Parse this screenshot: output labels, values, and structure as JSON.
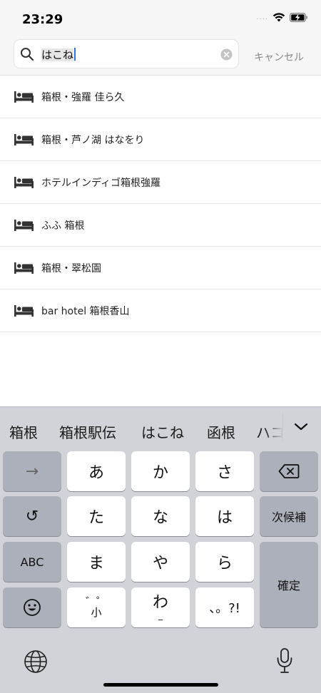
{
  "status_bar": {
    "time": "23:29",
    "signal": "....",
    "icons": [
      "wifi-icon",
      "battery-charging-icon"
    ]
  },
  "search": {
    "query_highlighted": "はこね",
    "cancel_label": "キャンセル",
    "icons": [
      "search-icon",
      "clear-icon"
    ]
  },
  "results": [
    {
      "label": "箱根・強羅 佳ら久",
      "icon": "bed-icon"
    },
    {
      "label": "箱根・芦ノ湖 はなをり",
      "icon": "bed-icon"
    },
    {
      "label": "ホテルインディゴ箱根強羅",
      "icon": "bed-icon"
    },
    {
      "label": "ふふ 箱根",
      "icon": "bed-icon"
    },
    {
      "label": "箱根・翠松園",
      "icon": "bed-icon"
    },
    {
      "label": "bar hotel 箱根香山",
      "icon": "bed-icon"
    }
  ],
  "keyboard": {
    "candidates": [
      "箱根",
      "箱根駅伝",
      "はこね",
      "函根",
      "ハコ"
    ],
    "keys": {
      "arrow": "→",
      "a": "あ",
      "ka": "か",
      "sa": "さ",
      "undo": "↺",
      "ta": "た",
      "na": "な",
      "ha": "は",
      "next_candidate": "次候補",
      "abc": "ABC",
      "ma": "ま",
      "ya": "や",
      "ra": "ら",
      "confirm": "確定",
      "dakuten": "゛゜",
      "dakuten_sub": "小",
      "wa": "わ",
      "wa_sub": "_",
      "punct": "、。?!"
    },
    "icons": [
      "backspace-icon",
      "emoji-icon",
      "globe-icon",
      "microphone-icon",
      "chevron-down-icon"
    ],
    "colors": {
      "key_light": "#ffffff",
      "key_dark": "#abb0ba",
      "background": "#d1d3d9"
    }
  }
}
